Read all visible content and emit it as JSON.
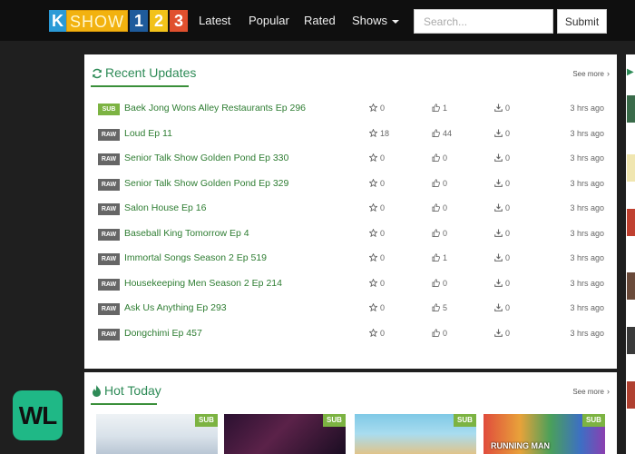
{
  "logo": {
    "k": "K",
    "show": "SHOW",
    "n1": "1",
    "n2": "2",
    "n3": "3"
  },
  "nav": {
    "latest": "Latest",
    "popular": "Popular",
    "rated": "Rated",
    "shows": "Shows"
  },
  "search": {
    "placeholder": "Search...",
    "submit_label": "Submit"
  },
  "recent": {
    "title": "Recent Updates",
    "see_more": "See more",
    "rows": [
      {
        "badge": "SUB",
        "title": "Baek Jong Wons Alley Restaurants Ep 296",
        "stars": "0",
        "likes": "1",
        "downloads": "0",
        "time": "3 hrs ago"
      },
      {
        "badge": "RAW",
        "title": "Loud Ep 11",
        "stars": "18",
        "likes": "44",
        "downloads": "0",
        "time": "3 hrs ago"
      },
      {
        "badge": "RAW",
        "title": "Senior Talk Show Golden Pond Ep 330",
        "stars": "0",
        "likes": "0",
        "downloads": "0",
        "time": "3 hrs ago"
      },
      {
        "badge": "RAW",
        "title": "Senior Talk Show Golden Pond Ep 329",
        "stars": "0",
        "likes": "0",
        "downloads": "0",
        "time": "3 hrs ago"
      },
      {
        "badge": "RAW",
        "title": "Salon House Ep 16",
        "stars": "0",
        "likes": "0",
        "downloads": "0",
        "time": "3 hrs ago"
      },
      {
        "badge": "RAW",
        "title": "Baseball King Tomorrow Ep 4",
        "stars": "0",
        "likes": "0",
        "downloads": "0",
        "time": "3 hrs ago"
      },
      {
        "badge": "RAW",
        "title": "Immortal Songs Season 2 Ep 519",
        "stars": "0",
        "likes": "1",
        "downloads": "0",
        "time": "3 hrs ago"
      },
      {
        "badge": "RAW",
        "title": "Housekeeping Men Season 2 Ep 214",
        "stars": "0",
        "likes": "0",
        "downloads": "0",
        "time": "3 hrs ago"
      },
      {
        "badge": "RAW",
        "title": "Ask Us Anything Ep 293",
        "stars": "0",
        "likes": "5",
        "downloads": "0",
        "time": "3 hrs ago"
      },
      {
        "badge": "RAW",
        "title": "Dongchimi Ep 457",
        "stars": "0",
        "likes": "0",
        "downloads": "0",
        "time": "3 hrs ago"
      }
    ]
  },
  "hot": {
    "title": "Hot Today",
    "see_more": "See more",
    "thumbs": [
      {
        "badge": "SUB",
        "caption": ""
      },
      {
        "badge": "SUB",
        "caption": ""
      },
      {
        "badge": "SUB",
        "caption": ""
      },
      {
        "badge": "SUB",
        "caption": "RUNNING MAN"
      }
    ]
  },
  "watermark": {
    "text": "WL"
  },
  "colors": {
    "accent": "#2e8b57",
    "sub_badge": "#7cb342",
    "raw_badge": "#666666",
    "navbar": "#0f0f0f",
    "background": "#1f1f1f"
  },
  "icons": {
    "refresh": "refresh-icon",
    "fire": "fire-icon",
    "star": "star-icon",
    "thumbs_up": "thumbs-up-icon",
    "download": "download-icon",
    "chevron": "chevron-right-icon"
  }
}
